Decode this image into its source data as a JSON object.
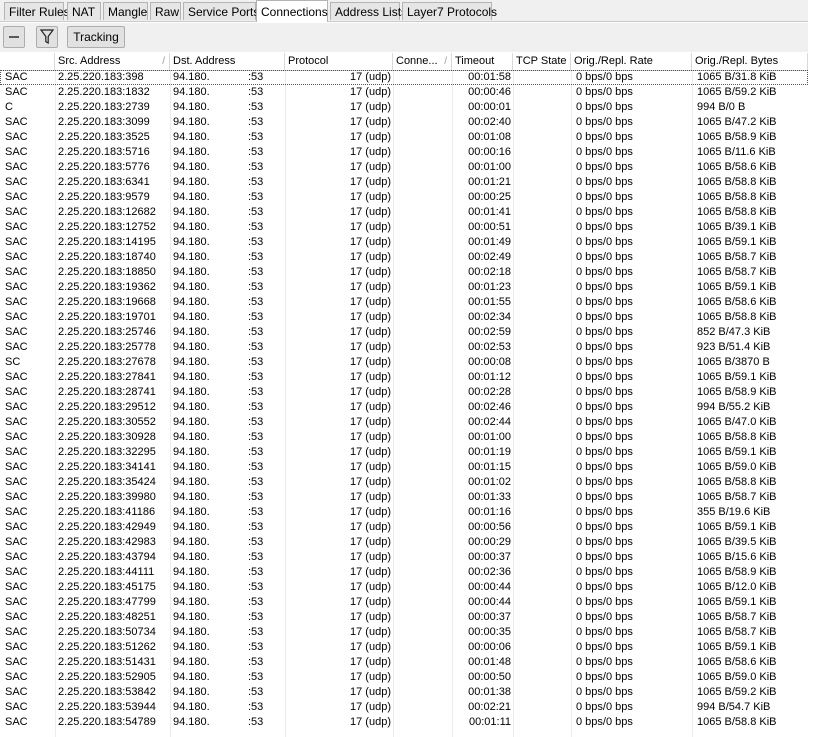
{
  "tabs": [
    "Filter Rules",
    "NAT",
    "Mangle",
    "Raw",
    "Service Ports",
    "Connections",
    "Address Lists",
    "Layer7 Protocols"
  ],
  "active_tab": "Connections",
  "toolbar": {
    "tracking_label": "Tracking"
  },
  "columns": [
    "Src. Address",
    "Dst. Address",
    "Protocol",
    "Conne...",
    "Timeout",
    "TCP State",
    "Orig./Repl. Rate",
    "Orig./Repl. Bytes"
  ],
  "rows": [
    {
      "flags": "SAC",
      "src": "2.25.220.183:398",
      "dst": "94.180.",
      "port": ":53",
      "proto": "17 (udp)",
      "timeout": "00:01:58",
      "rate": "0 bps/0 bps",
      "bytes": "1065 B/31.8 KiB"
    },
    {
      "flags": "SAC",
      "src": "2.25.220.183:1832",
      "dst": "94.180.",
      "port": ":53",
      "proto": "17 (udp)",
      "timeout": "00:00:46",
      "rate": "0 bps/0 bps",
      "bytes": "1065 B/59.2 KiB"
    },
    {
      "flags": "C",
      "src": "2.25.220.183:2739",
      "dst": "94.180.",
      "port": ":53",
      "proto": "17 (udp)",
      "timeout": "00:00:01",
      "rate": "0 bps/0 bps",
      "bytes": "994 B/0 B"
    },
    {
      "flags": "SAC",
      "src": "2.25.220.183:3099",
      "dst": "94.180.",
      "port": ":53",
      "proto": "17 (udp)",
      "timeout": "00:02:40",
      "rate": "0 bps/0 bps",
      "bytes": "1065 B/47.2 KiB"
    },
    {
      "flags": "SAC",
      "src": "2.25.220.183:3525",
      "dst": "94.180.",
      "port": ":53",
      "proto": "17 (udp)",
      "timeout": "00:01:08",
      "rate": "0 bps/0 bps",
      "bytes": "1065 B/58.9 KiB"
    },
    {
      "flags": "SAC",
      "src": "2.25.220.183:5716",
      "dst": "94.180.",
      "port": ":53",
      "proto": "17 (udp)",
      "timeout": "00:00:16",
      "rate": "0 bps/0 bps",
      "bytes": "1065 B/11.6 KiB"
    },
    {
      "flags": "SAC",
      "src": "2.25.220.183:5776",
      "dst": "94.180.",
      "port": ":53",
      "proto": "17 (udp)",
      "timeout": "00:01:00",
      "rate": "0 bps/0 bps",
      "bytes": "1065 B/58.6 KiB"
    },
    {
      "flags": "SAC",
      "src": "2.25.220.183:6341",
      "dst": "94.180.",
      "port": ":53",
      "proto": "17 (udp)",
      "timeout": "00:01:21",
      "rate": "0 bps/0 bps",
      "bytes": "1065 B/58.8 KiB"
    },
    {
      "flags": "SAC",
      "src": "2.25.220.183:9579",
      "dst": "94.180.",
      "port": ":53",
      "proto": "17 (udp)",
      "timeout": "00:00:25",
      "rate": "0 bps/0 bps",
      "bytes": "1065 B/58.8 KiB"
    },
    {
      "flags": "SAC",
      "src": "2.25.220.183:12682",
      "dst": "94.180.",
      "port": ":53",
      "proto": "17 (udp)",
      "timeout": "00:01:41",
      "rate": "0 bps/0 bps",
      "bytes": "1065 B/58.8 KiB"
    },
    {
      "flags": "SAC",
      "src": "2.25.220.183:12752",
      "dst": "94.180.",
      "port": ":53",
      "proto": "17 (udp)",
      "timeout": "00:00:51",
      "rate": "0 bps/0 bps",
      "bytes": "1065 B/39.1 KiB"
    },
    {
      "flags": "SAC",
      "src": "2.25.220.183:14195",
      "dst": "94.180.",
      "port": ":53",
      "proto": "17 (udp)",
      "timeout": "00:01:49",
      "rate": "0 bps/0 bps",
      "bytes": "1065 B/59.1 KiB"
    },
    {
      "flags": "SAC",
      "src": "2.25.220.183:18740",
      "dst": "94.180.",
      "port": ":53",
      "proto": "17 (udp)",
      "timeout": "00:02:49",
      "rate": "0 bps/0 bps",
      "bytes": "1065 B/58.7 KiB"
    },
    {
      "flags": "SAC",
      "src": "2.25.220.183:18850",
      "dst": "94.180.",
      "port": ":53",
      "proto": "17 (udp)",
      "timeout": "00:02:18",
      "rate": "0 bps/0 bps",
      "bytes": "1065 B/58.7 KiB"
    },
    {
      "flags": "SAC",
      "src": "2.25.220.183:19362",
      "dst": "94.180.",
      "port": ":53",
      "proto": "17 (udp)",
      "timeout": "00:01:23",
      "rate": "0 bps/0 bps",
      "bytes": "1065 B/59.1 KiB"
    },
    {
      "flags": "SAC",
      "src": "2.25.220.183:19668",
      "dst": "94.180.",
      "port": ":53",
      "proto": "17 (udp)",
      "timeout": "00:01:55",
      "rate": "0 bps/0 bps",
      "bytes": "1065 B/58.6 KiB"
    },
    {
      "flags": "SAC",
      "src": "2.25.220.183:19701",
      "dst": "94.180.",
      "port": ":53",
      "proto": "17 (udp)",
      "timeout": "00:02:34",
      "rate": "0 bps/0 bps",
      "bytes": "1065 B/58.8 KiB"
    },
    {
      "flags": "SAC",
      "src": "2.25.220.183:25746",
      "dst": "94.180.",
      "port": ":53",
      "proto": "17 (udp)",
      "timeout": "00:02:59",
      "rate": "0 bps/0 bps",
      "bytes": "852 B/47.3 KiB"
    },
    {
      "flags": "SAC",
      "src": "2.25.220.183:25778",
      "dst": "94.180.",
      "port": ":53",
      "proto": "17 (udp)",
      "timeout": "00:02:53",
      "rate": "0 bps/0 bps",
      "bytes": "923 B/51.4 KiB"
    },
    {
      "flags": "SC",
      "src": "2.25.220.183:27678",
      "dst": "94.180.",
      "port": ":53",
      "proto": "17 (udp)",
      "timeout": "00:00:08",
      "rate": "0 bps/0 bps",
      "bytes": "1065 B/3870 B"
    },
    {
      "flags": "SAC",
      "src": "2.25.220.183:27841",
      "dst": "94.180.",
      "port": ":53",
      "proto": "17 (udp)",
      "timeout": "00:01:12",
      "rate": "0 bps/0 bps",
      "bytes": "1065 B/59.1 KiB"
    },
    {
      "flags": "SAC",
      "src": "2.25.220.183:28741",
      "dst": "94.180.",
      "port": ":53",
      "proto": "17 (udp)",
      "timeout": "00:02:28",
      "rate": "0 bps/0 bps",
      "bytes": "1065 B/58.9 KiB"
    },
    {
      "flags": "SAC",
      "src": "2.25.220.183:29512",
      "dst": "94.180.",
      "port": ":53",
      "proto": "17 (udp)",
      "timeout": "00:02:46",
      "rate": "0 bps/0 bps",
      "bytes": "994 B/55.2 KiB"
    },
    {
      "flags": "SAC",
      "src": "2.25.220.183:30552",
      "dst": "94.180.",
      "port": ":53",
      "proto": "17 (udp)",
      "timeout": "00:02:44",
      "rate": "0 bps/0 bps",
      "bytes": "1065 B/47.0 KiB"
    },
    {
      "flags": "SAC",
      "src": "2.25.220.183:30928",
      "dst": "94.180.",
      "port": ":53",
      "proto": "17 (udp)",
      "timeout": "00:01:00",
      "rate": "0 bps/0 bps",
      "bytes": "1065 B/58.8 KiB"
    },
    {
      "flags": "SAC",
      "src": "2.25.220.183:32295",
      "dst": "94.180.",
      "port": ":53",
      "proto": "17 (udp)",
      "timeout": "00:01:19",
      "rate": "0 bps/0 bps",
      "bytes": "1065 B/59.1 KiB"
    },
    {
      "flags": "SAC",
      "src": "2.25.220.183:34141",
      "dst": "94.180.",
      "port": ":53",
      "proto": "17 (udp)",
      "timeout": "00:01:15",
      "rate": "0 bps/0 bps",
      "bytes": "1065 B/59.0 KiB"
    },
    {
      "flags": "SAC",
      "src": "2.25.220.183:35424",
      "dst": "94.180.",
      "port": ":53",
      "proto": "17 (udp)",
      "timeout": "00:01:02",
      "rate": "0 bps/0 bps",
      "bytes": "1065 B/58.8 KiB"
    },
    {
      "flags": "SAC",
      "src": "2.25.220.183:39980",
      "dst": "94.180.",
      "port": ":53",
      "proto": "17 (udp)",
      "timeout": "00:01:33",
      "rate": "0 bps/0 bps",
      "bytes": "1065 B/58.7 KiB"
    },
    {
      "flags": "SAC",
      "src": "2.25.220.183:41186",
      "dst": "94.180.",
      "port": ":53",
      "proto": "17 (udp)",
      "timeout": "00:01:16",
      "rate": "0 bps/0 bps",
      "bytes": "355 B/19.6 KiB"
    },
    {
      "flags": "SAC",
      "src": "2.25.220.183:42949",
      "dst": "94.180.",
      "port": ":53",
      "proto": "17 (udp)",
      "timeout": "00:00:56",
      "rate": "0 bps/0 bps",
      "bytes": "1065 B/59.1 KiB"
    },
    {
      "flags": "SAC",
      "src": "2.25.220.183:42983",
      "dst": "94.180.",
      "port": ":53",
      "proto": "17 (udp)",
      "timeout": "00:00:29",
      "rate": "0 bps/0 bps",
      "bytes": "1065 B/39.5 KiB"
    },
    {
      "flags": "SAC",
      "src": "2.25.220.183:43794",
      "dst": "94.180.",
      "port": ":53",
      "proto": "17 (udp)",
      "timeout": "00:00:37",
      "rate": "0 bps/0 bps",
      "bytes": "1065 B/15.6 KiB"
    },
    {
      "flags": "SAC",
      "src": "2.25.220.183:44111",
      "dst": "94.180.",
      "port": ":53",
      "proto": "17 (udp)",
      "timeout": "00:02:36",
      "rate": "0 bps/0 bps",
      "bytes": "1065 B/58.9 KiB"
    },
    {
      "flags": "SAC",
      "src": "2.25.220.183:45175",
      "dst": "94.180.",
      "port": ":53",
      "proto": "17 (udp)",
      "timeout": "00:00:44",
      "rate": "0 bps/0 bps",
      "bytes": "1065 B/12.0 KiB"
    },
    {
      "flags": "SAC",
      "src": "2.25.220.183:47799",
      "dst": "94.180.",
      "port": ":53",
      "proto": "17 (udp)",
      "timeout": "00:00:44",
      "rate": "0 bps/0 bps",
      "bytes": "1065 B/59.1 KiB"
    },
    {
      "flags": "SAC",
      "src": "2.25.220.183:48251",
      "dst": "94.180.",
      "port": ":53",
      "proto": "17 (udp)",
      "timeout": "00:00:37",
      "rate": "0 bps/0 bps",
      "bytes": "1065 B/58.7 KiB"
    },
    {
      "flags": "SAC",
      "src": "2.25.220.183:50734",
      "dst": "94.180.",
      "port": ":53",
      "proto": "17 (udp)",
      "timeout": "00:00:35",
      "rate": "0 bps/0 bps",
      "bytes": "1065 B/58.7 KiB"
    },
    {
      "flags": "SAC",
      "src": "2.25.220.183:51262",
      "dst": "94.180.",
      "port": ":53",
      "proto": "17 (udp)",
      "timeout": "00:00:06",
      "rate": "0 bps/0 bps",
      "bytes": "1065 B/59.1 KiB"
    },
    {
      "flags": "SAC",
      "src": "2.25.220.183:51431",
      "dst": "94.180.",
      "port": ":53",
      "proto": "17 (udp)",
      "timeout": "00:01:48",
      "rate": "0 bps/0 bps",
      "bytes": "1065 B/58.6 KiB"
    },
    {
      "flags": "SAC",
      "src": "2.25.220.183:52905",
      "dst": "94.180.",
      "port": ":53",
      "proto": "17 (udp)",
      "timeout": "00:00:50",
      "rate": "0 bps/0 bps",
      "bytes": "1065 B/59.0 KiB"
    },
    {
      "flags": "SAC",
      "src": "2.25.220.183:53842",
      "dst": "94.180.",
      "port": ":53",
      "proto": "17 (udp)",
      "timeout": "00:01:38",
      "rate": "0 bps/0 bps",
      "bytes": "1065 B/59.2 KiB"
    },
    {
      "flags": "SAC",
      "src": "2.25.220.183:53944",
      "dst": "94.180.",
      "port": ":53",
      "proto": "17 (udp)",
      "timeout": "00:02:21",
      "rate": "0 bps/0 bps",
      "bytes": "994 B/54.7 KiB"
    },
    {
      "flags": "SAC",
      "src": "2.25.220.183:54789",
      "dst": "94.180.",
      "port": ":53",
      "proto": "17 (udp)",
      "timeout": "00:01:11",
      "rate": "0 bps/0 bps",
      "bytes": "1065 B/58.8 KiB"
    }
  ]
}
